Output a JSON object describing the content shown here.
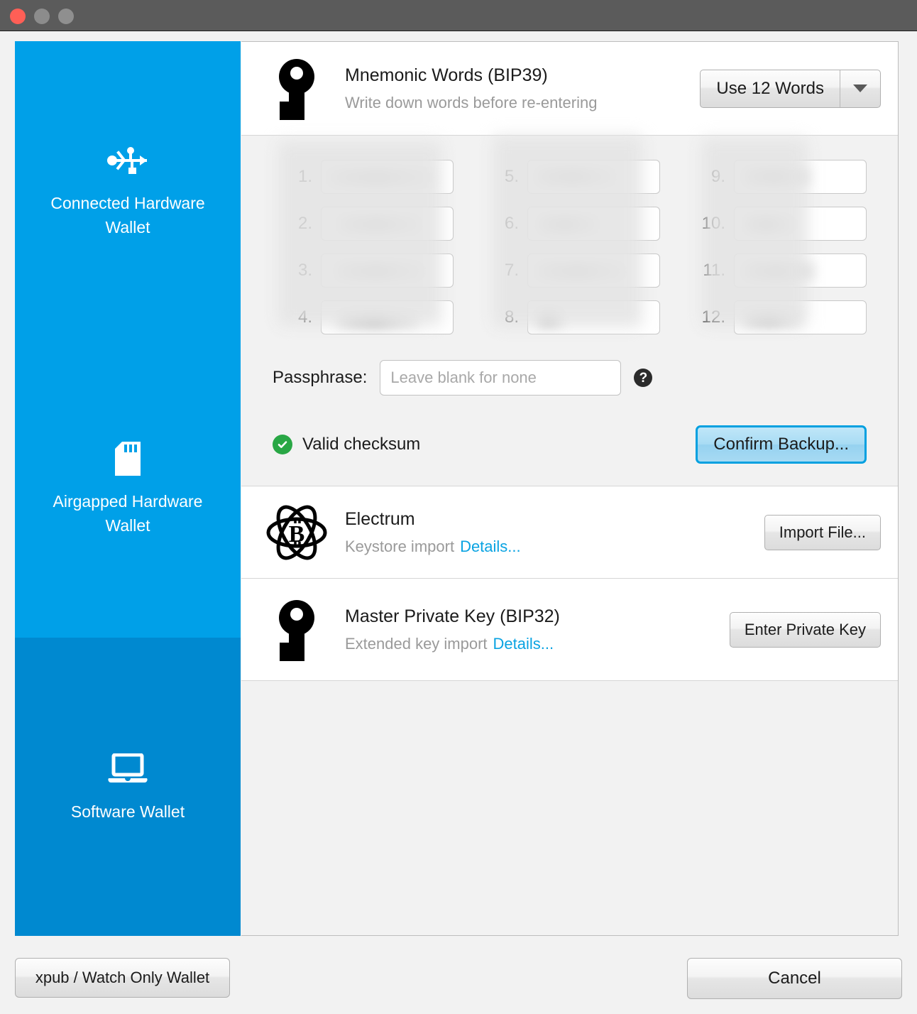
{
  "window": {
    "titlebar": {
      "close_label": "Close",
      "minimize_label": "Minimize",
      "maximize_label": "Maximize"
    },
    "title": ""
  },
  "sidebar": {
    "items": [
      {
        "label": "Connected Hardware Wallet",
        "icon": "usb-icon",
        "selected": false
      },
      {
        "label": "Airgapped Hardware Wallet",
        "icon": "sd-card-icon",
        "selected": false
      },
      {
        "label": "Software Wallet",
        "icon": "laptop-icon",
        "selected": true
      }
    ]
  },
  "main": {
    "mnemonic": {
      "icon": "key-icon",
      "title": "Mnemonic Words (BIP39)",
      "subtitle": "Write down words before re-entering",
      "word_count_button": "Use 12 Words",
      "word_count_caret": "chevron-down-icon",
      "words": [
        {
          "num": "1.",
          "value": "",
          "redacted": true
        },
        {
          "num": "2.",
          "value": "",
          "redacted": true
        },
        {
          "num": "3.",
          "value": "",
          "redacted": true
        },
        {
          "num": "4.",
          "value": "",
          "redacted": true
        },
        {
          "num": "5.",
          "value": "",
          "redacted": true
        },
        {
          "num": "6.",
          "value": "",
          "redacted": true
        },
        {
          "num": "7.",
          "value": "",
          "redacted": true
        },
        {
          "num": "8.",
          "value": "",
          "redacted": true
        },
        {
          "num": "9.",
          "value": "",
          "redacted": true
        },
        {
          "num": "10.",
          "value": "",
          "redacted": true
        },
        {
          "num": "11.",
          "value": "",
          "redacted": true
        },
        {
          "num": "12.",
          "value": "",
          "redacted": true
        }
      ],
      "passphrase_label": "Passphrase:",
      "passphrase_value": "",
      "passphrase_placeholder": "Leave blank for none",
      "help_glyph": "?",
      "checksum_status": "Valid checksum",
      "checksum_icon": "check-circle-icon",
      "confirm_button": "Confirm Backup...",
      "annotation": {
        "type": "arrow",
        "color": "#f41f6b",
        "points_to": "confirm-backup-button"
      }
    },
    "electrum": {
      "icon": "electrum-atom-icon",
      "title": "Electrum",
      "subtitle": "Keystore import",
      "details_link": "Details...",
      "action_button": "Import File..."
    },
    "master_key": {
      "icon": "key-icon",
      "title": "Master Private Key (BIP32)",
      "subtitle": "Extended key import",
      "details_link": "Details...",
      "action_button": "Enter Private Key"
    }
  },
  "footer": {
    "xpub_button": "xpub / Watch Only Wallet",
    "cancel_button": "Cancel"
  },
  "colors": {
    "sidebar_blue": "#00a0e8",
    "sidebar_selected_blue": "#0089d0",
    "link_blue": "#0aa3e2",
    "success_green": "#29a745",
    "accent_border": "#00a0e0",
    "annotation_pink": "#f41f6b",
    "titlebar_grey": "#5b5b5b"
  }
}
